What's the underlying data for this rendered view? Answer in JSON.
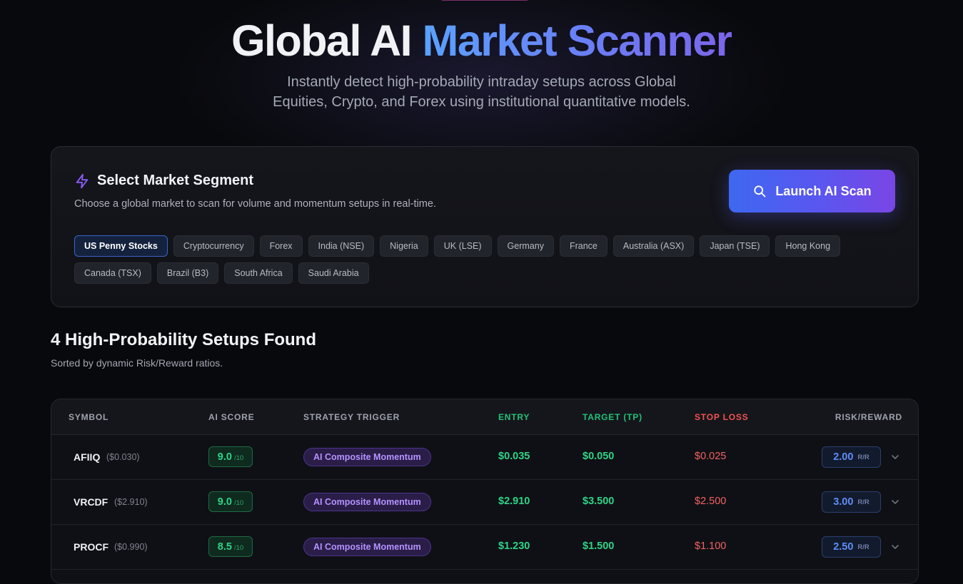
{
  "hero": {
    "title_white": "Global AI",
    "title_gradient": "Market Scanner",
    "subtitle_line1": "Instantly detect high-probability intraday setups across Global",
    "subtitle_line2": "Equities, Crypto, and Forex using institutional quantitative models."
  },
  "panel": {
    "icon": "bolt-icon",
    "title": "Select Market Segment",
    "description": "Choose a global market to scan for volume and momentum setups in real-time.",
    "launch_label": "Launch AI Scan",
    "launch_icon": "search-icon",
    "selected_market": "US Penny Stocks",
    "markets": [
      "US Penny Stocks",
      "Cryptocurrency",
      "Forex",
      "India (NSE)",
      "Nigeria",
      "UK (LSE)",
      "Germany",
      "France",
      "Australia (ASX)",
      "Japan (TSE)",
      "Hong Kong",
      "Canada (TSX)",
      "Brazil (B3)",
      "South Africa",
      "Saudi Arabia"
    ]
  },
  "results": {
    "title": "4 High-Probability Setups Found",
    "subtitle": "Sorted by dynamic Risk/Reward ratios.",
    "columns": {
      "symbol": "SYMBOL",
      "ai_score": "AI SCORE",
      "strategy": "STRATEGY TRIGGER",
      "entry": "ENTRY",
      "target": "TARGET (TP)",
      "stop": "STOP LOSS",
      "rr": "RISK/REWARD"
    },
    "rows": [
      {
        "symbol": "AFIIQ",
        "price": "($0.030)",
        "score": "9.0",
        "score_den": "/10",
        "strategy": "AI Composite Momentum",
        "entry": "$0.035",
        "target": "$0.050",
        "stop": "$0.025",
        "rr": "2.00",
        "rr_unit": "R/R"
      },
      {
        "symbol": "VRCDF",
        "price": "($2.910)",
        "score": "9.0",
        "score_den": "/10",
        "strategy": "AI Composite Momentum",
        "entry": "$2.910",
        "target": "$3.500",
        "stop": "$2.500",
        "rr": "3.00",
        "rr_unit": "R/R"
      },
      {
        "symbol": "PROCF",
        "price": "($0.990)",
        "score": "8.5",
        "score_den": "/10",
        "strategy": "AI Composite Momentum",
        "entry": "$1.230",
        "target": "$1.500",
        "stop": "$1.100",
        "rr": "2.50",
        "rr_unit": "R/R"
      }
    ]
  },
  "colors": {
    "accent_blue": "#5aa2ff",
    "accent_purple": "#7b65ea",
    "positive": "#2fd487",
    "negative": "#f06262"
  }
}
